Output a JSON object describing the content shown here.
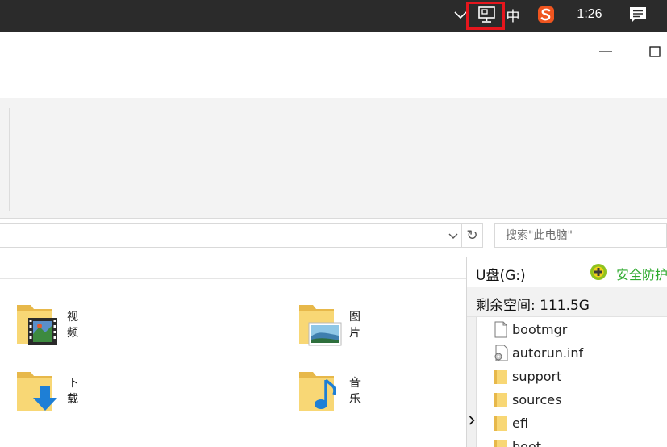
{
  "taskbar": {
    "tray_icons": [
      "chevron-up-icon",
      "network-icon",
      "ime-mode",
      "sogou-ime-icon",
      "notification-icon"
    ],
    "ime_mode": "中",
    "clock": "1:26",
    "highlight_color": "#e6161d"
  },
  "window": {
    "minimize_glyph": "—",
    "maximize_glyph": "☐"
  },
  "address_bar": {
    "refresh_glyph": "↻"
  },
  "search": {
    "placeholder": "搜索\"此电脑\""
  },
  "folders": [
    {
      "label": "视频",
      "icon": "video-folder-icon"
    },
    {
      "label": "图片",
      "icon": "pictures-folder-icon"
    },
    {
      "label": "下载",
      "icon": "downloads-folder-icon"
    },
    {
      "label": "音乐",
      "icon": "music-folder-icon"
    }
  ],
  "drive_panel": {
    "name": "U盘(G:)",
    "safety_label": "安全防护",
    "safety_color": "#2eaa2e",
    "free_space": "剩余空间: 111.5G",
    "expander_glyph": "›",
    "files": [
      {
        "name": "bootmgr",
        "type": "file"
      },
      {
        "name": "autorun.inf",
        "type": "config"
      },
      {
        "name": "support",
        "type": "folder"
      },
      {
        "name": "sources",
        "type": "folder"
      },
      {
        "name": "efi",
        "type": "folder"
      },
      {
        "name": "boot",
        "type": "folder"
      }
    ]
  }
}
